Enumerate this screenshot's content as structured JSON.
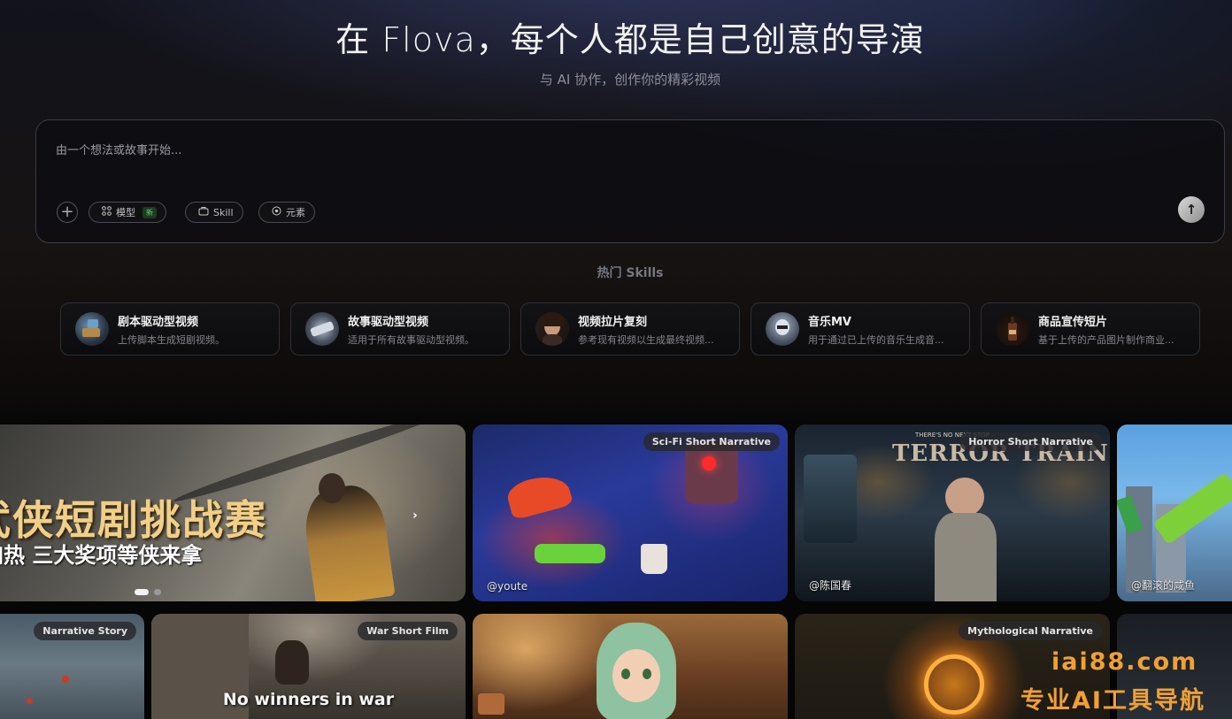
{
  "hero": {
    "title": "在 Flova，每个人都是自己创意的导演",
    "subtitle": "与 AI 协作，创作你的精彩视频"
  },
  "prompt": {
    "placeholder": "由一个想法或故事开始...",
    "add_icon": "plus-icon",
    "buttons": [
      {
        "label": "模型",
        "icon": "grid-icon",
        "badge": "新"
      },
      {
        "label": "Skill",
        "icon": "skill-icon"
      },
      {
        "label": "元素",
        "icon": "element-icon"
      }
    ],
    "send_icon": "arrow-up-icon"
  },
  "skills": {
    "heading": "热门 Skills",
    "items": [
      {
        "name": "剧本驱动型视频",
        "desc": "上传脚本生成短剧视频。"
      },
      {
        "name": "故事驱动型视频",
        "desc": "适用于所有故事驱动型视频。"
      },
      {
        "name": "视频拉片复刻",
        "desc": "参考现有视频以生成最终视频..."
      },
      {
        "name": "音乐MV",
        "desc": "用于通过已上传的音乐生成音..."
      },
      {
        "name": "商品宣传短片",
        "desc": "基于上传的产品图片制作商业..."
      }
    ]
  },
  "gallery": {
    "banner": {
      "title": "武侠短剧挑战赛",
      "subtitle": "加热  三大奖项等侠来拿",
      "next_icon": "chevron-right-icon"
    },
    "row1": [
      {
        "tag": "Sci-Fi Short Narrative",
        "author": "@youte"
      },
      {
        "tag": "Horror Short Narrative",
        "author": "@陈国春",
        "poster_top": "THERE'S NO NEXT STOP",
        "poster_title": "TERROR TRAIN"
      },
      {
        "author": "@翻滚的咸鱼"
      }
    ],
    "row2": [
      {
        "tag": "Narrative Story"
      },
      {
        "tag": "War Short Film",
        "caption": "No winners in war"
      },
      {},
      {
        "tag": "Mythological Narrative"
      }
    ]
  },
  "watermark": {
    "site": "iai88.com",
    "text": "专业AI工具导航"
  }
}
